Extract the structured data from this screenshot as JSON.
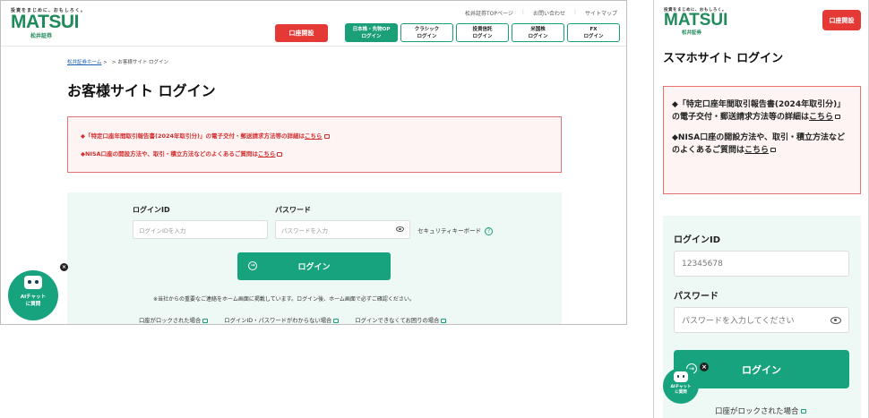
{
  "desktop": {
    "logo": {
      "tagline": "投資をまじめに、おもしろく。",
      "word": "MATSUI",
      "sub": "松井証券"
    },
    "top_links": [
      "松井証券TOPページ",
      "お問い合わせ",
      "サイトマップ"
    ],
    "open_account": "口座開設",
    "tabs": [
      {
        "line1": "日本株・先物OP",
        "line2": "ログイン"
      },
      {
        "line1": "クラシック",
        "line2": "ログイン"
      },
      {
        "line1": "投資信託",
        "line2": "ログイン"
      },
      {
        "line1": "米国株",
        "line2": "ログイン"
      },
      {
        "line1": "FX",
        "line2": "ログイン"
      }
    ],
    "breadcrumb": {
      "home": "松井証券ホーム",
      "sep": ">",
      "current": "お客様サイト ログイン"
    },
    "title": "お客様サイト ログイン",
    "notices": [
      {
        "text": "◆「特定口座年間取引報告書(2024年取引分)」の電子交付・郵送請求方法等の詳細は",
        "link": "こちら"
      },
      {
        "text": "◆NISA口座の開設方法や、取引・積立方法などのよくあるご質問は",
        "link": "こちら"
      }
    ],
    "form": {
      "login_id_label": "ログインID",
      "login_id_placeholder": "ログインIDを入力",
      "password_label": "パスワード",
      "password_placeholder": "パスワードを入力",
      "security_keyboard": "セキュリティキーボード",
      "help": "?",
      "login_button": "ログイン",
      "note": "※当社からの重要なご連絡をホーム画面に掲載しています。ログイン後、ホーム画面で必ずご確認ください。",
      "links": [
        "口座がロックされた場合",
        "ログインID・パスワードがわからない場合",
        "ログインできなくてお困りの場合"
      ]
    },
    "chat": {
      "line1": "AIチャット",
      "line2": "に質問"
    }
  },
  "mobile": {
    "logo": {
      "tagline": "投資をまじめに、おもしろく。",
      "word": "MATSUI",
      "sub": "松井証券"
    },
    "open_account": "口座開設",
    "title": "スマホサイト ログイン",
    "notices": [
      {
        "text": "◆「特定口座年間取引報告書(2024年取引分)」の電子交付・郵送請求方法等の詳細は",
        "link": "こちら"
      },
      {
        "text": "◆NISA口座の開設方法や、取引・積立方法などのよくあるご質問は",
        "link": "こちら"
      }
    ],
    "form": {
      "login_id_label": "ログインID",
      "login_id_value": "12345678",
      "password_label": "パスワード",
      "password_placeholder": "パスワードを入力してください",
      "login_button": "ログイン",
      "link": "口座がロックされた場合"
    },
    "chat": {
      "line1": "AIチャット",
      "line2": "に質問"
    }
  },
  "colors": {
    "brand_green": "#1b9f78",
    "alert_red": "#e53935",
    "notice_bg": "#fff4f4"
  }
}
